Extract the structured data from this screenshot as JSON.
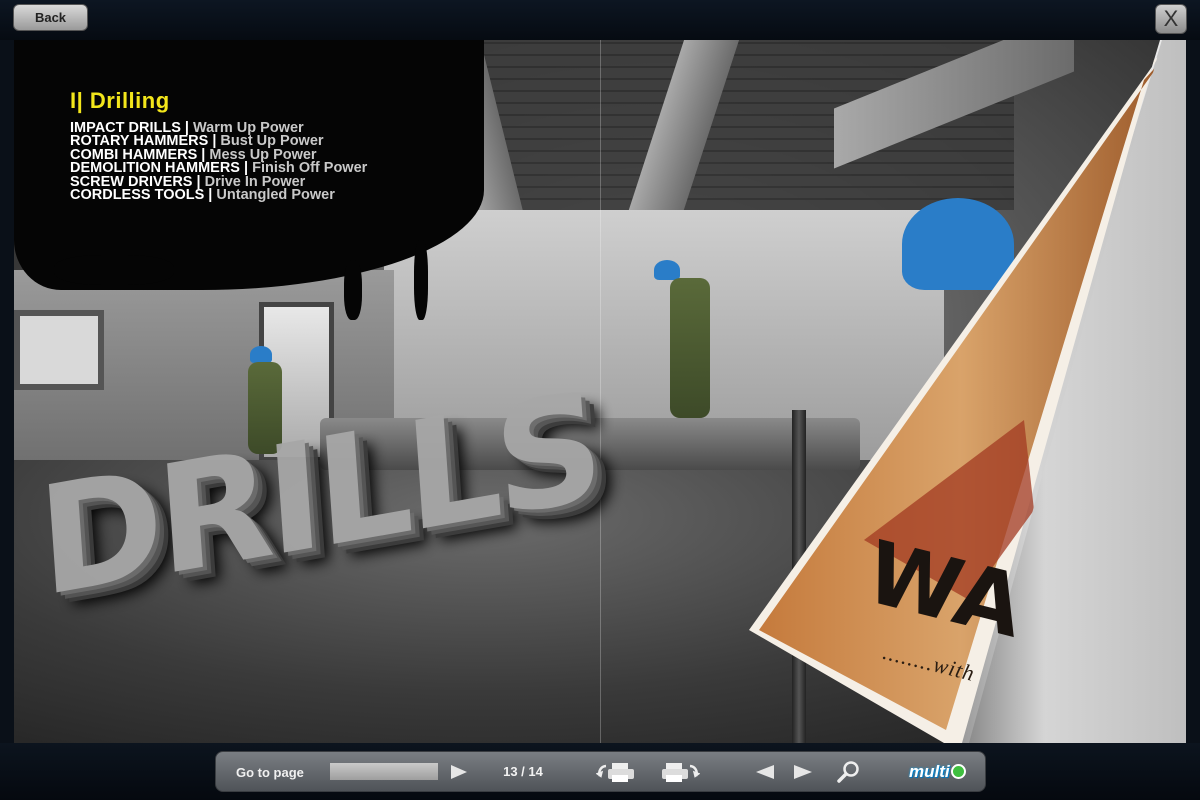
{
  "top_bar": {
    "back_label": "Back",
    "close_label": "X"
  },
  "spread": {
    "section_title": "I| Drilling",
    "products": [
      {
        "name": "IMPACT DRILLS",
        "tag": "Warm Up Power"
      },
      {
        "name": "ROTARY HAMMERS",
        "tag": "Bust Up Power"
      },
      {
        "name": "COMBI HAMMERS",
        "tag": "Mess Up Power"
      },
      {
        "name": "DEMOLITION HAMMERS",
        "tag": "Finish Off Power"
      },
      {
        "name": "SCREW DRIVERS",
        "tag": " Drive In Power"
      },
      {
        "name": "CORDLESS TOOLS",
        "tag": "Untangled Power"
      }
    ],
    "big_word": "DRILLS",
    "curl_word": "WA",
    "curl_subtext": "........with"
  },
  "toolbar": {
    "goto_label": "Go to page",
    "goto_value": "",
    "page_counter": "13 / 14",
    "logo_text": "multi",
    "icons": {
      "go": "play-arrow-icon",
      "print_left": "print-left-page-icon",
      "print_right": "print-right-page-icon",
      "prev": "previous-page-icon",
      "next": "next-page-icon",
      "zoom": "zoom-magnifier-icon"
    }
  },
  "colors": {
    "title_yellow": "#f3e61b",
    "helmet_blue": "#2a7dc8",
    "toolbar_grey": "#6a6e73"
  }
}
